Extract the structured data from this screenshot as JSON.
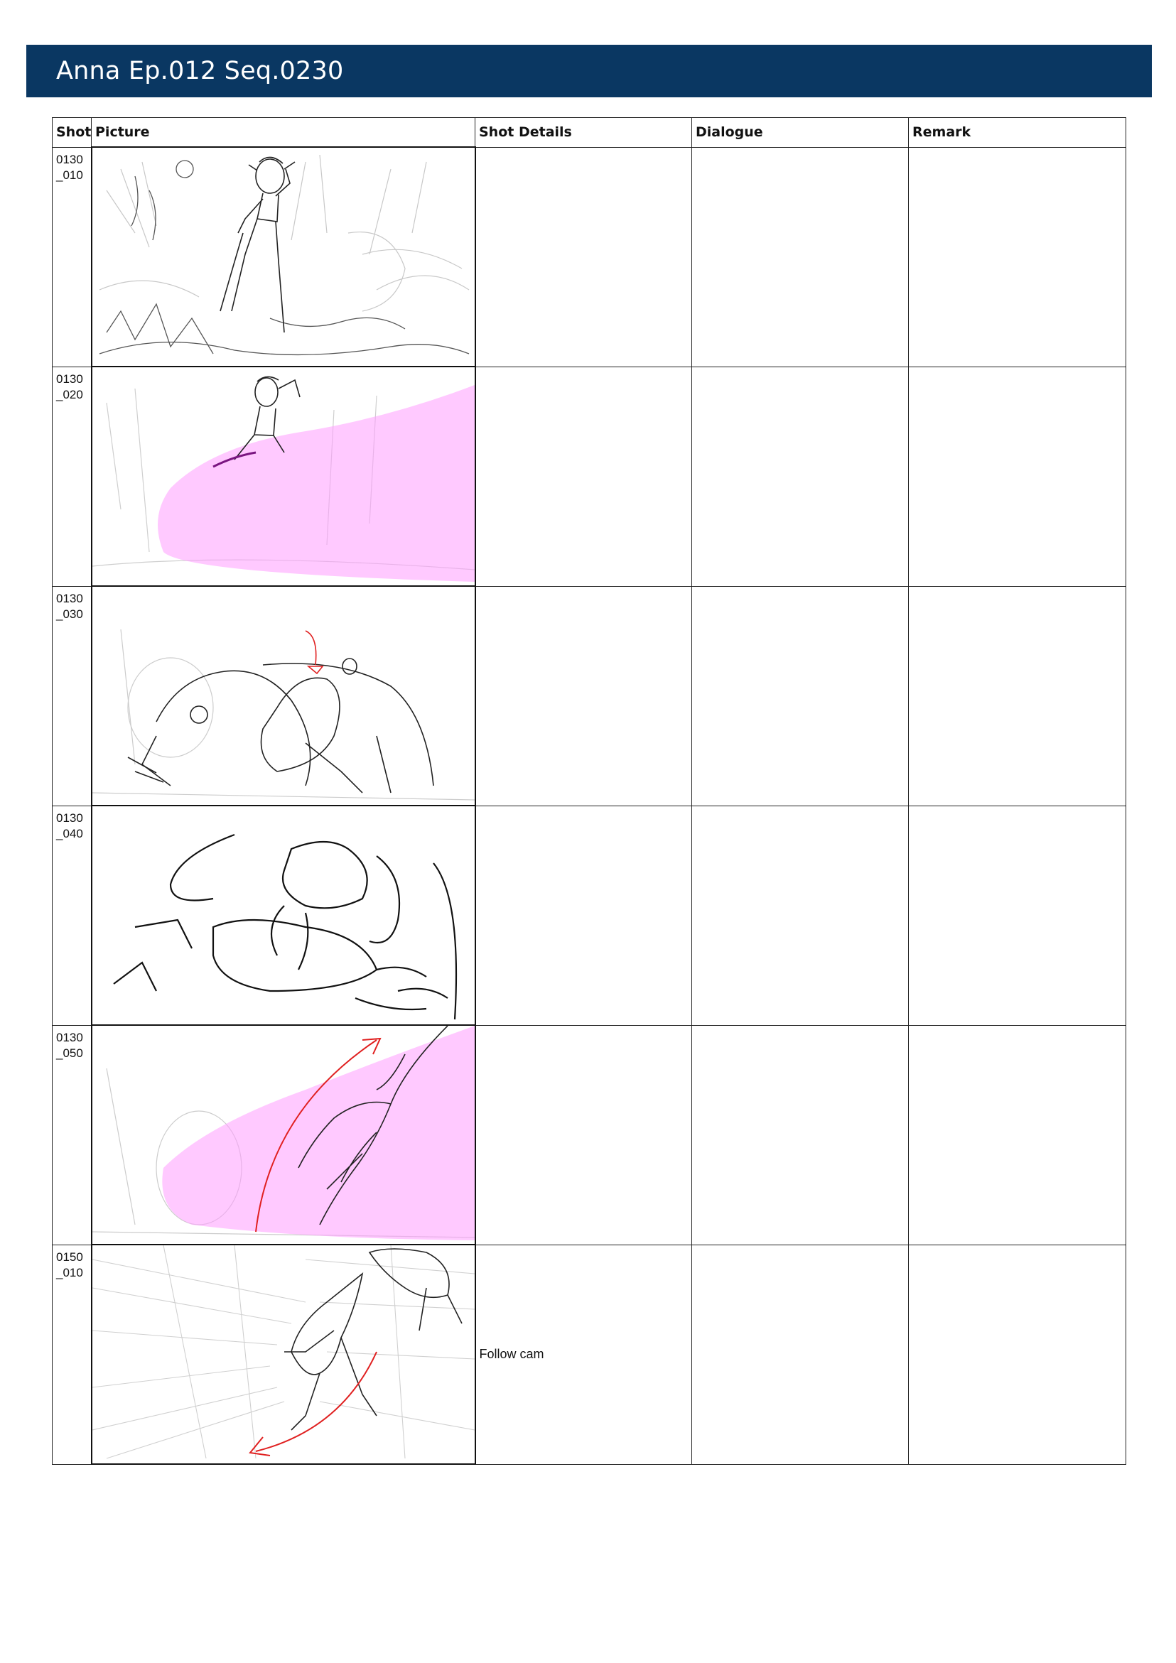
{
  "header": {
    "title": "Anna Ep.012 Seq.0230"
  },
  "table": {
    "columns": {
      "shot": "Shot",
      "picture": "Picture",
      "shot_details": "Shot Details",
      "dialogue": "Dialogue",
      "remark": "Remark"
    },
    "rows": [
      {
        "shot_line1": "0130",
        "shot_line2": "_010",
        "shot_details": "",
        "dialogue": "",
        "remark": ""
      },
      {
        "shot_line1": "0130",
        "shot_line2": "_020",
        "shot_details": "",
        "dialogue": "",
        "remark": ""
      },
      {
        "shot_line1": "0130",
        "shot_line2": "_030",
        "shot_details": "",
        "dialogue": "",
        "remark": ""
      },
      {
        "shot_line1": "0130",
        "shot_line2": "_040",
        "shot_details": "",
        "dialogue": "",
        "remark": ""
      },
      {
        "shot_line1": "0130",
        "shot_line2": "_050",
        "shot_details": "",
        "dialogue": "",
        "remark": ""
      },
      {
        "shot_line1": "0150",
        "shot_line2": "_010",
        "shot_details": "Follow cam",
        "dialogue": "",
        "remark": ""
      }
    ]
  },
  "colors": {
    "title_bar": "#0a3762",
    "title_text": "#ffffff",
    "effect_pink": "#ff9cff",
    "arrow_red": "#e02020"
  }
}
